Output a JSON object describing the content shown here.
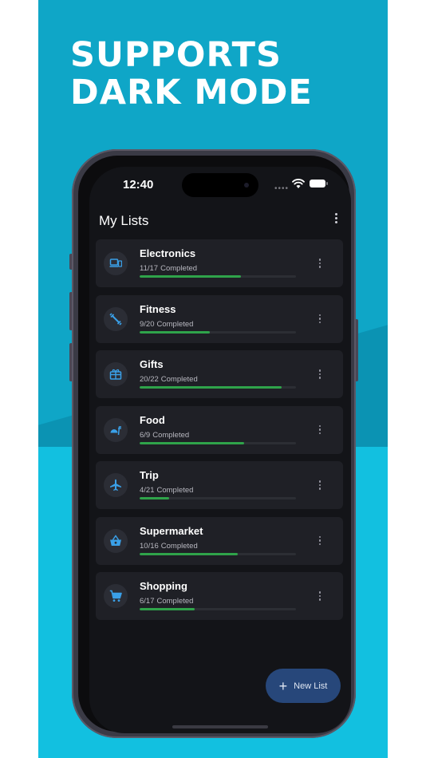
{
  "promo": {
    "headline_line1": "SUPPORTS",
    "headline_line2": "DARK MODE"
  },
  "colors": {
    "background": "#0fa6c7",
    "screen": "#131418",
    "card": "#1f2026",
    "icon": "#3aa0e8",
    "progress": "#2fa34a",
    "fab": "#27477a"
  },
  "status_bar": {
    "time": "12:40"
  },
  "app": {
    "title": "My Lists",
    "menu_icon": "more-vertical-icon",
    "fab_label": "New List",
    "fab_icon": "plus-icon"
  },
  "lists": [
    {
      "name": "Electronics",
      "done": 11,
      "total": 17,
      "count": "11/17",
      "status": "Completed",
      "icon": "devices-icon"
    },
    {
      "name": "Fitness",
      "done": 9,
      "total": 20,
      "count": "9/20",
      "status": "Completed",
      "icon": "fitness-icon"
    },
    {
      "name": "Gifts",
      "done": 20,
      "total": 22,
      "count": "20/22",
      "status": "Completed",
      "icon": "gift-icon"
    },
    {
      "name": "Food",
      "done": 6,
      "total": 9,
      "count": "6/9",
      "status": "Completed",
      "icon": "food-icon"
    },
    {
      "name": "Trip",
      "done": 4,
      "total": 21,
      "count": "4/21",
      "status": "Completed",
      "icon": "airplane-icon"
    },
    {
      "name": "Supermarket",
      "done": 10,
      "total": 16,
      "count": "10/16",
      "status": "Completed",
      "icon": "basket-icon"
    },
    {
      "name": "Shopping",
      "done": 6,
      "total": 17,
      "count": "6/17",
      "status": "Completed",
      "icon": "cart-icon"
    }
  ]
}
